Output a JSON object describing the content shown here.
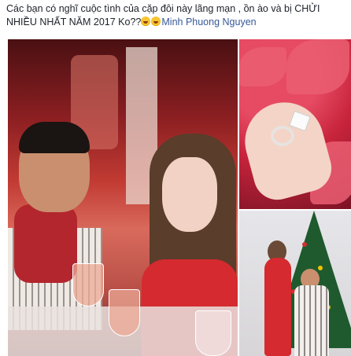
{
  "post": {
    "text": "Các bạn có nghĩ cuộc tình của cặp đôi này lãng mạn , ồn ào và bị CHỬI NHIỀU NHẤT NĂM 2017 Ko??",
    "emoji_icons": [
      "grinning-sweat-emoji",
      "grinning-sweat-emoji"
    ],
    "author": "Minh Phuong Nguyen"
  },
  "colors": {
    "author_link": "#365899",
    "text": "#1d2129"
  }
}
